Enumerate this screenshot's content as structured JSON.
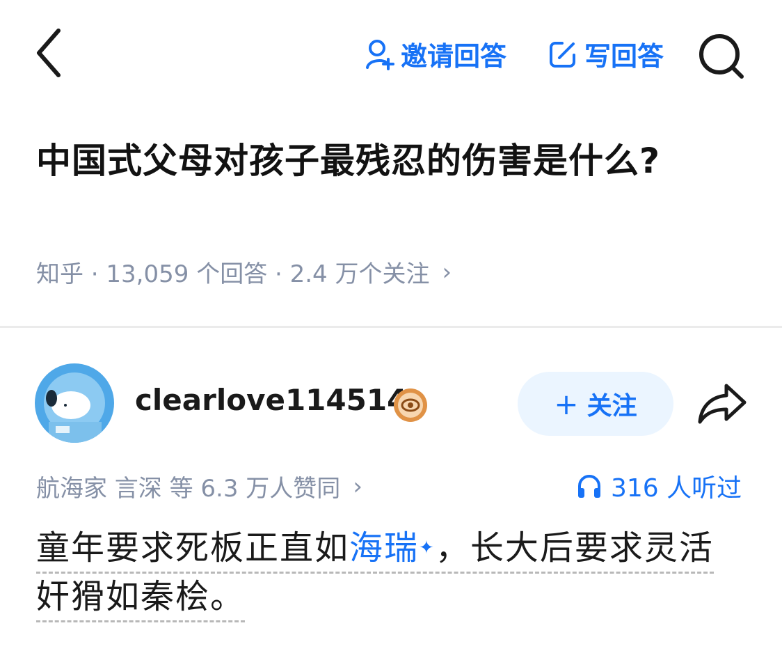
{
  "topbar": {
    "invite_label": "邀请回答",
    "write_label": "写回答",
    "icons": [
      "back-icon",
      "invite-user-icon",
      "edit-icon",
      "search-icon"
    ],
    "accent": "#1772f6"
  },
  "question": {
    "title": "中国式父母对孩子最残忍的伤害是什么?",
    "meta": "知乎 · 13,059 个回答 · 2.4 万个关注",
    "chevron": "›"
  },
  "answer": {
    "author_name": "clearlove114514",
    "follow_label": "关注",
    "follow_plus": "+",
    "votes": "航海家 言深 等 6.3 万人赞同",
    "votes_chevron": "›",
    "listen": "316 人听过",
    "body_pre": "童年要求死板正直如",
    "body_link": "海瑞",
    "body_spark": "✦",
    "body_post": "，长大后要求灵活奸猾如秦桧。"
  }
}
